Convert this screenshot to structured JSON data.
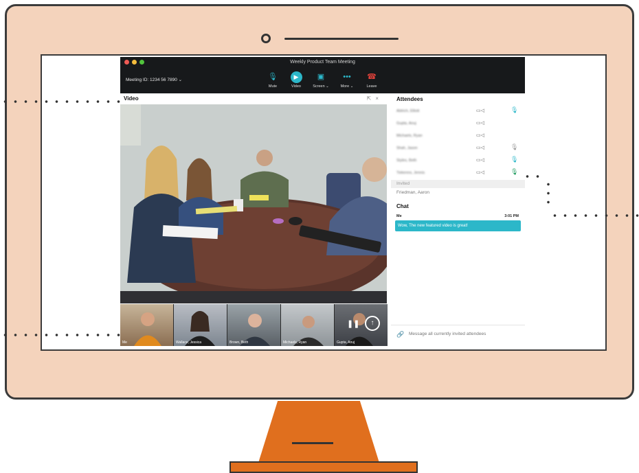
{
  "window": {
    "title": "Weekly Product Team Meeting"
  },
  "meeting": {
    "id_label": "Meeting ID: 1234 56 7890 ⌄"
  },
  "toolbar": [
    {
      "name": "mute-button",
      "icon": "microphone-icon",
      "glyph": "🎙",
      "label": "Mute"
    },
    {
      "name": "video-button",
      "icon": "video-camera-icon",
      "glyph": "▶",
      "label": "Video"
    },
    {
      "name": "screen-button",
      "icon": "screen-share-icon",
      "glyph": "▣",
      "label": "Screen ⌄"
    },
    {
      "name": "more-button",
      "icon": "more-dots-icon",
      "glyph": "•••",
      "label": "More ⌄"
    },
    {
      "name": "leave-button",
      "icon": "hang-up-icon",
      "glyph": "☎",
      "label": "Leave"
    }
  ],
  "video_panel": {
    "title": "Video",
    "popout_icon": "popout-icon",
    "close_icon": "close-icon"
  },
  "thumbnails": [
    {
      "name": "Me"
    },
    {
      "name": "Wallace, Jessica"
    },
    {
      "name": "Brown, Beth"
    },
    {
      "name": "Michaels, Ryan"
    },
    {
      "name": "Gupta, Anuj"
    }
  ],
  "attendees": {
    "title": "Attendees",
    "list": [
      {
        "name": "Aldrich, Elliott",
        "mic": "mic-active"
      },
      {
        "name": "Gupta, Anuj",
        "mic": "none"
      },
      {
        "name": "Michaels, Ryan",
        "mic": "none"
      },
      {
        "name": "Shah, Jason",
        "mic": "mic-muted"
      },
      {
        "name": "Styles, Beth",
        "mic": "mic-active"
      },
      {
        "name": "Tiekenns, Jennis",
        "mic": "mic-speaking"
      }
    ]
  },
  "invited": {
    "label": "Invited",
    "names": [
      "Friedman, Aaron"
    ]
  },
  "chat": {
    "title": "Chat",
    "messages": [
      {
        "sender": "Me",
        "time": "3:01 PM",
        "text": "Wow, The new featured video is great!"
      }
    ],
    "placeholder": "Message all currently invited attendees"
  },
  "colors": {
    "accent": "#2cb7c9",
    "leave": "#e0413a",
    "monitor": "#f4d3bc",
    "stand": "#e06f1e"
  }
}
